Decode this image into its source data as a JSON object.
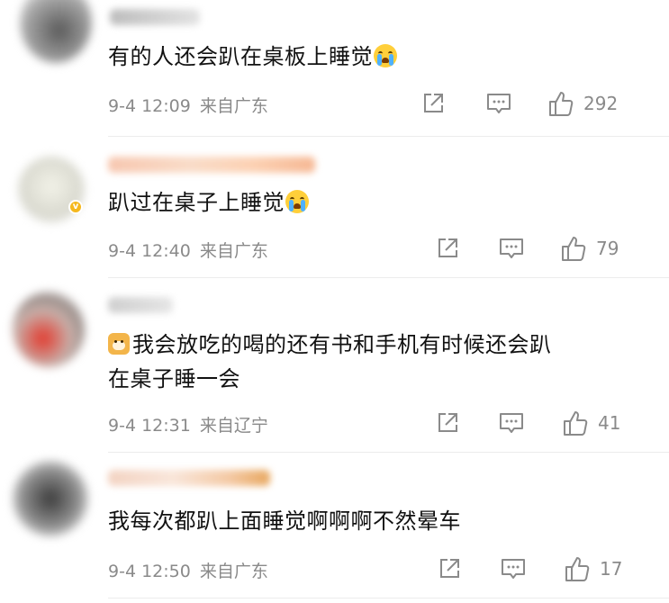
{
  "comments": [
    {
      "text": "有的人还会趴在桌板上睡觉",
      "emoji_before": "",
      "emoji_after": "crying-face",
      "date": "9-4 12:09",
      "location": "来自广东",
      "likes": "292",
      "verified": false
    },
    {
      "text": "趴过在桌子上睡觉",
      "emoji_before": "",
      "emoji_after": "crying-face",
      "date": "9-4 12:40",
      "location": "来自广东",
      "likes": "79",
      "verified": true
    },
    {
      "text_line1": "我会放吃的喝的还有书和手机有时候还会趴",
      "text_line2": "在桌子睡一会",
      "emoji_before": "dog-face",
      "emoji_after": "",
      "date": "9-4 12:31",
      "location": "来自辽宁",
      "likes": "41",
      "verified": false
    },
    {
      "text": "我每次都趴上面睡觉啊啊啊不然晕车",
      "emoji_before": "",
      "emoji_after": "",
      "date": "9-4 12:50",
      "location": "来自广东",
      "likes": "17",
      "verified": false
    }
  ],
  "icons": {
    "share": "share-icon",
    "comment": "comment-icon",
    "like": "thumbs-up-icon",
    "verified": "verified-badge-icon"
  },
  "colors": {
    "text": "#111111",
    "meta": "#8a8a8a",
    "verified_badge": "#f5b81e"
  }
}
